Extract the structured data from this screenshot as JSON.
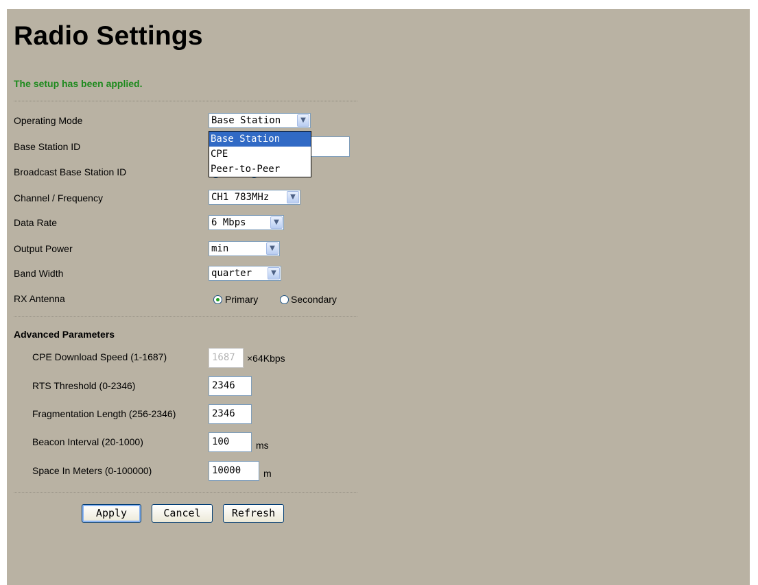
{
  "page_title": "Radio Settings",
  "status_message": "The setup has been applied.",
  "fields": {
    "operating_mode": {
      "label": "Operating Mode",
      "value": "Base Station",
      "options": [
        "Base Station",
        "CPE",
        "Peer-to-Peer"
      ],
      "open": true
    },
    "base_station_id": {
      "label": "Base Station ID",
      "value": ""
    },
    "broadcast_base_station_id": {
      "label": "Broadcast Base Station ID"
    },
    "channel_frequency": {
      "label": "Channel / Frequency",
      "value": "CH1 783MHz"
    },
    "data_rate": {
      "label": "Data Rate",
      "value": "6 Mbps"
    },
    "output_power": {
      "label": "Output Power",
      "value": "min"
    },
    "band_width": {
      "label": "Band Width",
      "value": "quarter"
    },
    "rx_antenna": {
      "label": "RX Antenna",
      "options": [
        "Primary",
        "Secondary"
      ],
      "selected": "Primary"
    }
  },
  "advanced": {
    "title": "Advanced Parameters",
    "cpe_download_speed": {
      "label": "CPE Download Speed (1-1687)",
      "value": "1687",
      "unit": "×64Kbps",
      "disabled": true
    },
    "rts_threshold": {
      "label": "RTS Threshold (0-2346)",
      "value": "2346"
    },
    "fragmentation_length": {
      "label": "Fragmentation Length (256-2346)",
      "value": "2346"
    },
    "beacon_interval": {
      "label": "Beacon Interval (20-1000)",
      "value": "100",
      "unit": "ms"
    },
    "space_in_meters": {
      "label": "Space In Meters (0-100000)",
      "value": "10000",
      "unit": "m"
    }
  },
  "buttons": {
    "apply": "Apply",
    "cancel": "Cancel",
    "refresh": "Refresh"
  },
  "colors": {
    "panel_background": "#b9b2a3",
    "status_text": "#1d8a1d",
    "dropdown_highlight": "#316ac5"
  }
}
